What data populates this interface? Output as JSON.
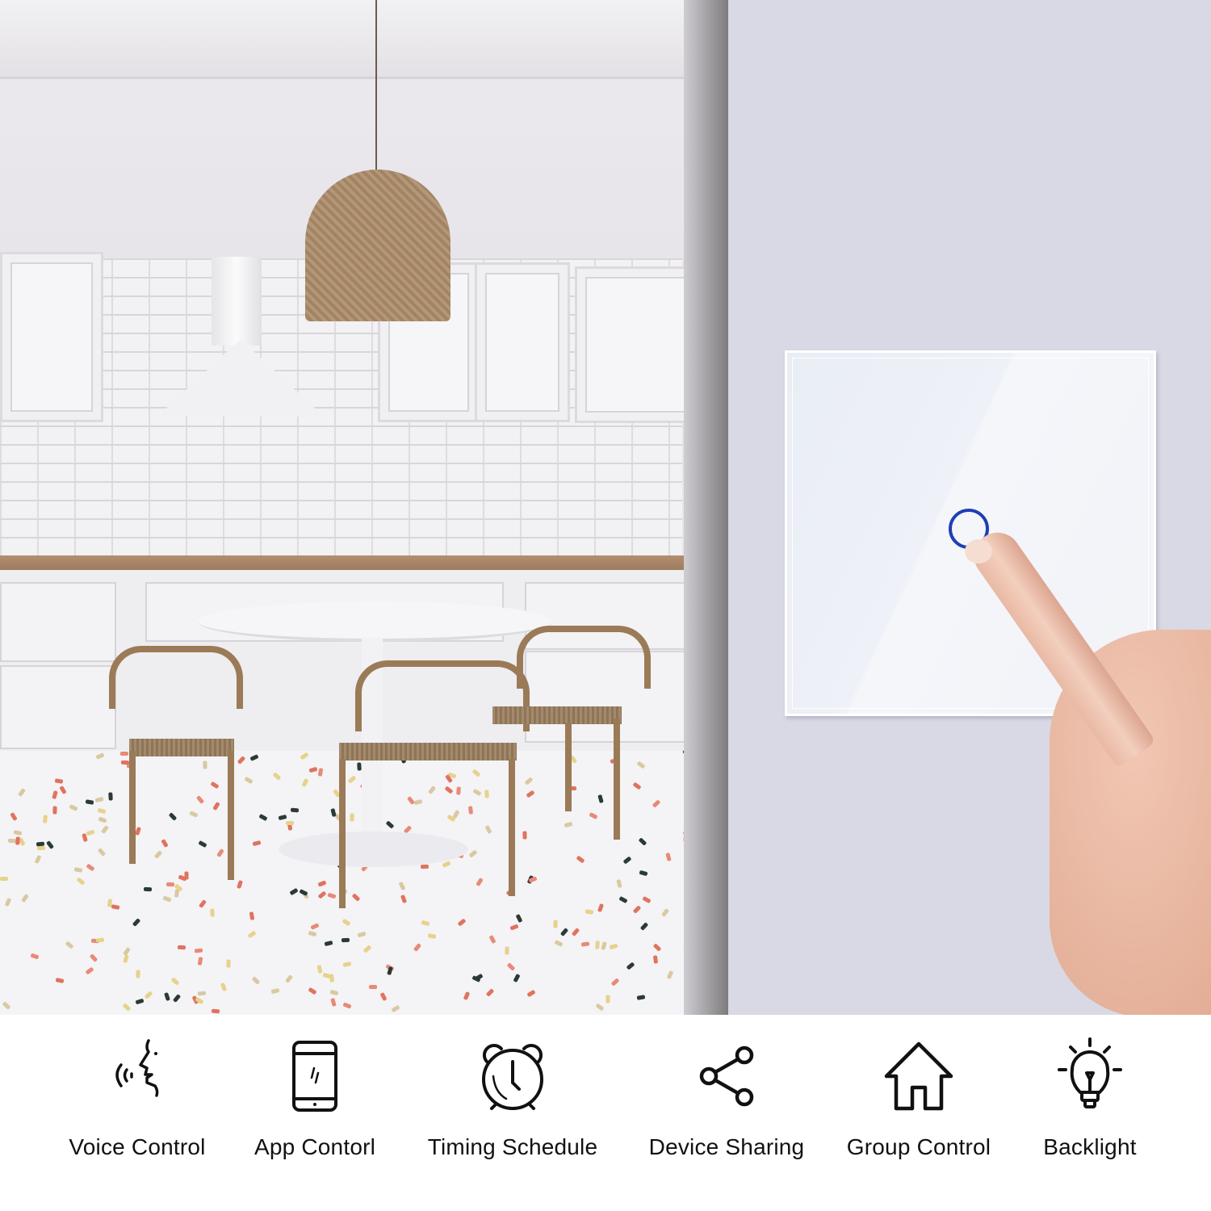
{
  "scene": {
    "left_photo": "kitchen-interior",
    "right_photo": "wall-touch-switch",
    "wall_color": "#d9d8e5",
    "switch_panel_color": "#eef1f7",
    "indicator_ring_color": "#1f3fb3",
    "switch_gangs": 1
  },
  "features": [
    {
      "icon": "voice-icon",
      "label": "Voice Control"
    },
    {
      "icon": "smartphone-icon",
      "label": "App Contorl"
    },
    {
      "icon": "alarm-clock-icon",
      "label": "Timing Schedule"
    },
    {
      "icon": "share-icon",
      "label": "Device Sharing"
    },
    {
      "icon": "home-icon",
      "label": "Group Control"
    },
    {
      "icon": "lightbulb-icon",
      "label": "Backlight"
    }
  ]
}
